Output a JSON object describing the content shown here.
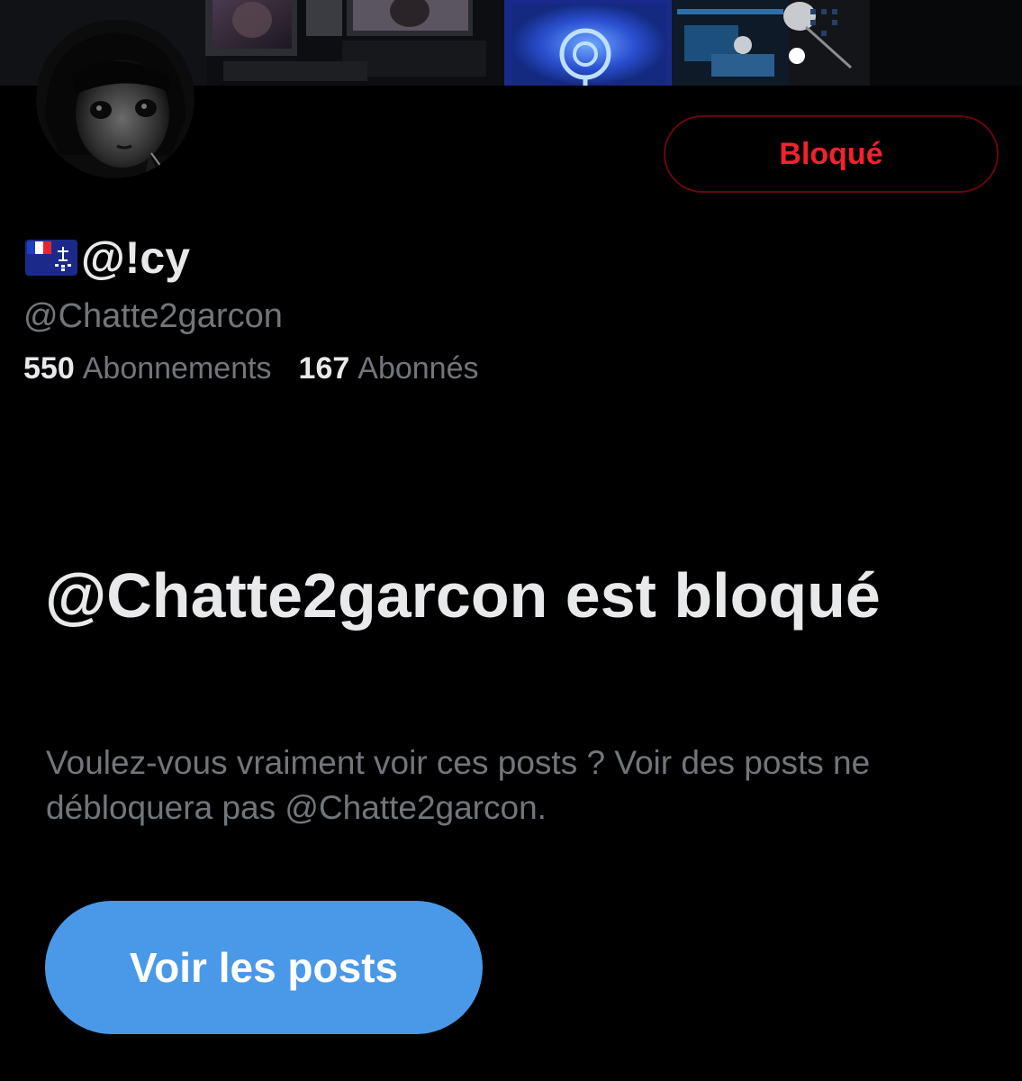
{
  "colors": {
    "background": "#000000",
    "primary_text": "#e7e9ea",
    "secondary_text": "#71767b",
    "blocked_red": "#f4212e",
    "blocked_border": "#67070f",
    "accent_blue": "#4a99e9"
  },
  "header": {
    "banner_icon": "cover-photo",
    "avatar_icon": "profile-avatar"
  },
  "actions": {
    "blocked_label": "Bloqué"
  },
  "profile": {
    "flag_icon": "flag-french-southern-territories",
    "display_name": "@!cy",
    "handle": "@Chatte2garcon",
    "stats": {
      "following_count": "550",
      "following_label": "Abonnements",
      "followers_count": "167",
      "followers_label": "Abonnés"
    }
  },
  "blocked_notice": {
    "title": "@Chatte2garcon est bloqué",
    "description": "Voulez-vous vraiment voir ces posts ? Voir des posts ne débloquera pas @Chatte2garcon.",
    "button_label": "Voir les posts"
  }
}
